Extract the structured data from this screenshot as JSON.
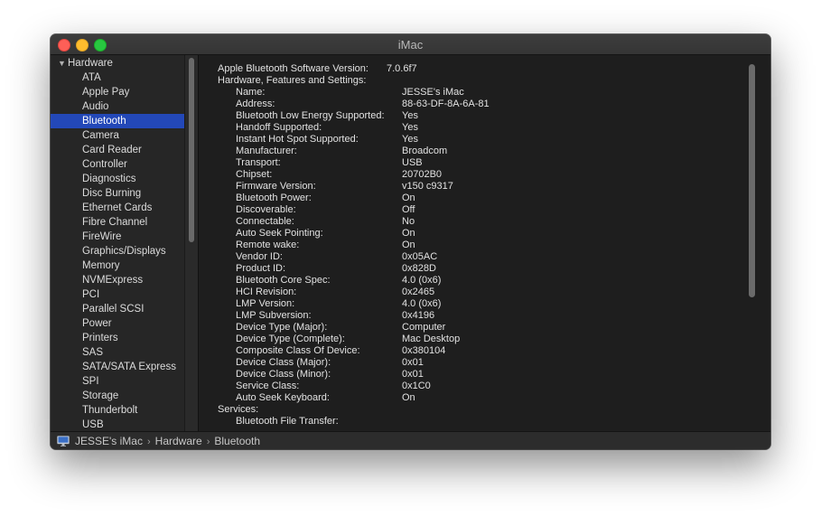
{
  "window": {
    "title": "iMac"
  },
  "sidebar": {
    "group": "Hardware",
    "items": [
      "ATA",
      "Apple Pay",
      "Audio",
      "Bluetooth",
      "Camera",
      "Card Reader",
      "Controller",
      "Diagnostics",
      "Disc Burning",
      "Ethernet Cards",
      "Fibre Channel",
      "FireWire",
      "Graphics/Displays",
      "Memory",
      "NVMExpress",
      "PCI",
      "Parallel SCSI",
      "Power",
      "Printers",
      "SAS",
      "SATA/SATA Express",
      "SPI",
      "Storage",
      "Thunderbolt",
      "USB"
    ],
    "selected": "Bluetooth"
  },
  "content": {
    "version_label": "Apple Bluetooth Software Version:",
    "version_value": "7.0.6f7",
    "section_label": "Hardware, Features and Settings:",
    "properties": [
      {
        "label": "Name:",
        "value": "JESSE's iMac"
      },
      {
        "label": "Address:",
        "value": "88-63-DF-8A-6A-81"
      },
      {
        "label": "Bluetooth Low Energy Supported:",
        "value": "Yes"
      },
      {
        "label": "Handoff Supported:",
        "value": "Yes"
      },
      {
        "label": "Instant Hot Spot Supported:",
        "value": "Yes"
      },
      {
        "label": "Manufacturer:",
        "value": "Broadcom"
      },
      {
        "label": "Transport:",
        "value": "USB"
      },
      {
        "label": "Chipset:",
        "value": "20702B0"
      },
      {
        "label": "Firmware Version:",
        "value": "v150 c9317"
      },
      {
        "label": "Bluetooth Power:",
        "value": "On"
      },
      {
        "label": "Discoverable:",
        "value": "Off"
      },
      {
        "label": "Connectable:",
        "value": "No"
      },
      {
        "label": "Auto Seek Pointing:",
        "value": "On"
      },
      {
        "label": "Remote wake:",
        "value": "On"
      },
      {
        "label": "Vendor ID:",
        "value": "0x05AC"
      },
      {
        "label": "Product ID:",
        "value": "0x828D"
      },
      {
        "label": "Bluetooth Core Spec:",
        "value": "4.0 (0x6)"
      },
      {
        "label": "HCI Revision:",
        "value": "0x2465"
      },
      {
        "label": "LMP Version:",
        "value": "4.0 (0x6)"
      },
      {
        "label": "LMP Subversion:",
        "value": "0x4196"
      },
      {
        "label": "Device Type (Major):",
        "value": "Computer"
      },
      {
        "label": "Device Type (Complete):",
        "value": "Mac Desktop"
      },
      {
        "label": "Composite Class Of Device:",
        "value": "0x380104"
      },
      {
        "label": "Device Class (Major):",
        "value": "0x01"
      },
      {
        "label": "Device Class (Minor):",
        "value": "0x01"
      },
      {
        "label": "Service Class:",
        "value": "0x1C0"
      },
      {
        "label": "Auto Seek Keyboard:",
        "value": "On"
      }
    ],
    "services_label": "Services:",
    "service_name": "Bluetooth File Transfer:"
  },
  "statusbar": {
    "crumbs": [
      "JESSE's iMac",
      "Hardware",
      "Bluetooth"
    ],
    "separator": "›"
  },
  "colors": {
    "selection": "#2348b8",
    "background": "#1e1e1e",
    "text": "#e2e2e2"
  }
}
